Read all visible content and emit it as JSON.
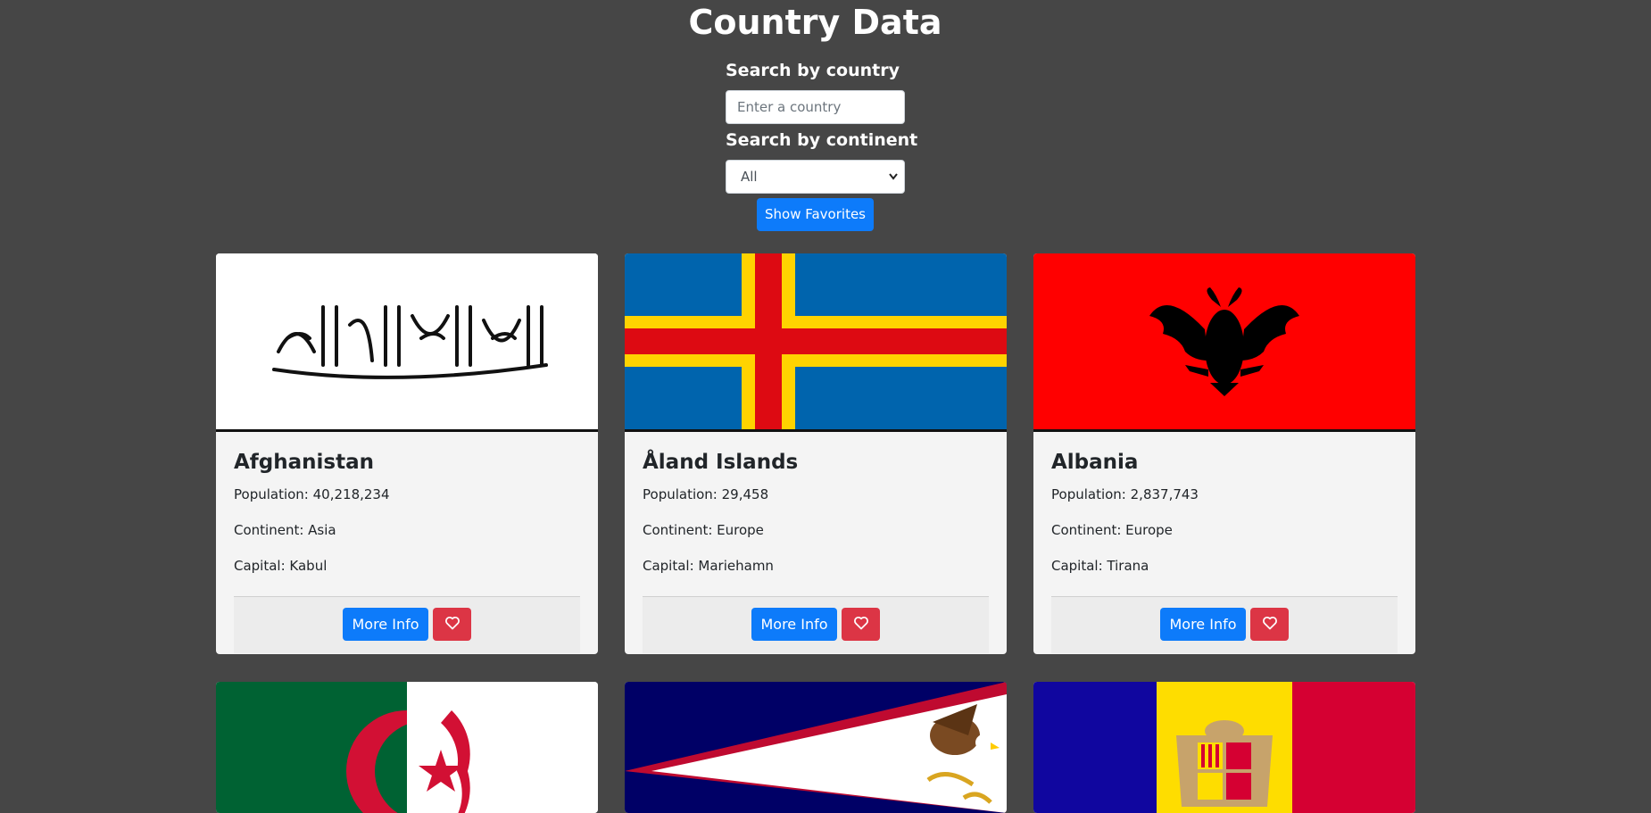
{
  "page": {
    "title": "Country Data"
  },
  "search": {
    "country_label": "Search by country",
    "country_placeholder": "Enter a country",
    "country_value": "",
    "continent_label": "Search by continent",
    "continent_selected": "All"
  },
  "favorites_button": "Show Favorites",
  "cards": [
    {
      "name": "Afghanistan",
      "population": "Population: 40,218,234",
      "continent": "Continent: Asia",
      "capital": "Capital: Kabul",
      "more_info": "More Info",
      "heart_icon": "heart-outline-icon"
    },
    {
      "name": "Åland Islands",
      "population": "Population: 29,458",
      "continent": "Continent: Europe",
      "capital": "Capital: Mariehamn",
      "more_info": "More Info",
      "heart_icon": "heart-outline-icon"
    },
    {
      "name": "Albania",
      "population": "Population: 2,837,743",
      "continent": "Continent: Europe",
      "capital": "Capital: Tirana",
      "more_info": "More Info",
      "heart_icon": "heart-outline-icon"
    }
  ],
  "partial_cards": [
    {
      "flag": "algeria-flag"
    },
    {
      "flag": "american-samoa-flag"
    },
    {
      "flag": "andorra-flag"
    }
  ],
  "colors": {
    "background": "#464646",
    "primary": "#0d7bfa",
    "danger": "#dc3545",
    "card": "#f4f4f4"
  }
}
